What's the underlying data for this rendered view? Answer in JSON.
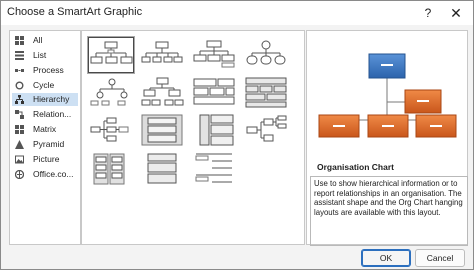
{
  "window": {
    "title": "Choose a SmartArt Graphic",
    "help_glyph": "?",
    "close_glyph": "✕"
  },
  "categories": [
    {
      "label": "All",
      "icon": "grid-icon"
    },
    {
      "label": "List",
      "icon": "list-icon"
    },
    {
      "label": "Process",
      "icon": "process-icon"
    },
    {
      "label": "Cycle",
      "icon": "cycle-icon"
    },
    {
      "label": "Hierarchy",
      "icon": "hierarchy-icon",
      "selected": true
    },
    {
      "label": "Relation...",
      "icon": "relationship-icon"
    },
    {
      "label": "Matrix",
      "icon": "matrix-icon"
    },
    {
      "label": "Pyramid",
      "icon": "pyramid-icon"
    },
    {
      "label": "Picture",
      "icon": "picture-icon"
    },
    {
      "label": "Office.co...",
      "icon": "office-icon"
    }
  ],
  "preview": {
    "title": "Organisation Chart",
    "description": "Use to show hierarchical information or to report relationships in an organisation. The assistant shape and the Org Chart hanging layouts are available with this layout.",
    "colors": {
      "top": "#3a78c2",
      "child": "#e26a23"
    }
  },
  "buttons": {
    "ok": "OK",
    "cancel": "Cancel"
  },
  "colors": {
    "selected_bg": "#cde0f3",
    "accent": "#2c6fbe"
  }
}
